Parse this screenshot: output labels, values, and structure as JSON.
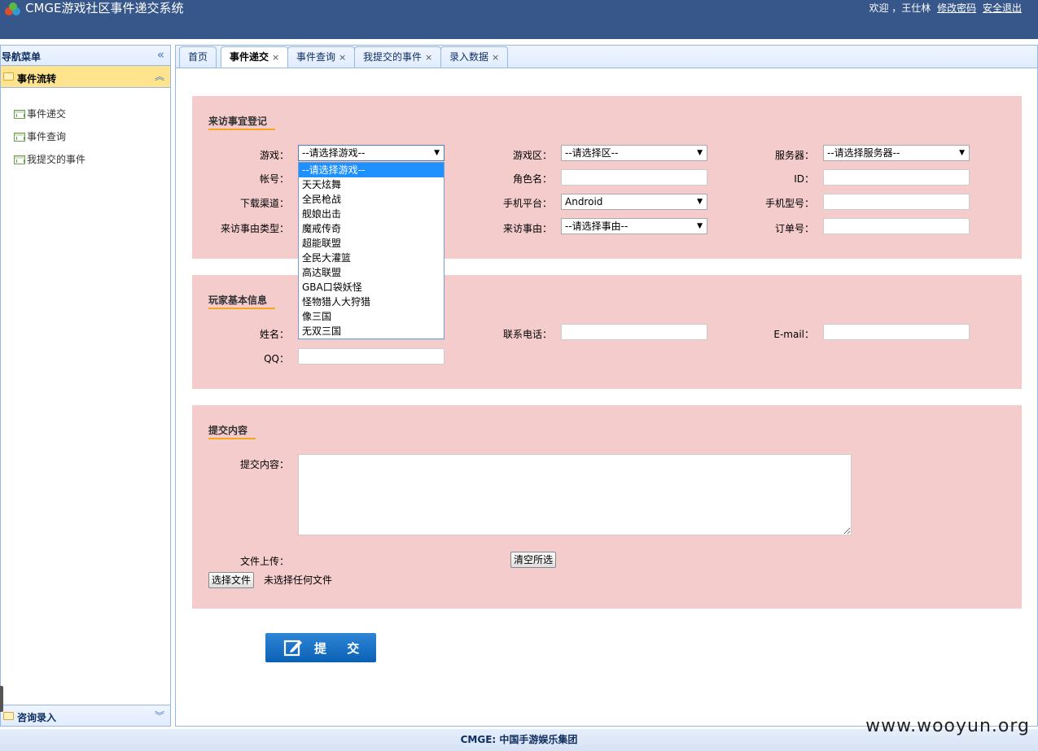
{
  "header": {
    "app_title": "CMGE游戏社区事件递交系统",
    "welcome": "欢迎 ，王仕林",
    "change_password": "修改密码",
    "logout": "安全退出"
  },
  "sidebar": {
    "title": "导航菜单",
    "section": "事件流转",
    "items": [
      {
        "label": "事件递交"
      },
      {
        "label": "事件查询"
      },
      {
        "label": "我提交的事件"
      }
    ],
    "bottom_section": "咨询录入"
  },
  "tabs": [
    {
      "label": "首页",
      "closable": false
    },
    {
      "label": "事件递交",
      "closable": true,
      "active": true
    },
    {
      "label": "事件查询",
      "closable": true
    },
    {
      "label": "我提交的事件",
      "closable": true
    },
    {
      "label": "录入数据",
      "closable": true
    }
  ],
  "tab_close_glyph": "×",
  "visit_panel": {
    "title": "来访事宜登记",
    "game_label": "游戏：",
    "game_value": "--请选择游戏--",
    "zone_label": "游戏区：",
    "zone_value": "--请选择区--",
    "server_label": "服务器：",
    "server_value": "--请选择服务器--",
    "account_label": "帐号：",
    "role_label": "角色名：",
    "id_label": "ID：",
    "channel_label": "下载渠道：",
    "platform_label": "手机平台：",
    "platform_value": "Android",
    "model_label": "手机型号：",
    "reason_type_label": "来访事由类型：",
    "reason_label": "来访事由：",
    "reason_value": "--请选择事由--",
    "order_label": "订单号："
  },
  "game_dropdown_options": [
    "--请选择游戏--",
    "天天炫舞",
    "全民枪战",
    "舰娘出击",
    "魔戒传奇",
    "超能联盟",
    "全民大灌篮",
    "高达联盟",
    "GBA口袋妖怪",
    "怪物猎人大狩猎",
    "像三国",
    "无双三国"
  ],
  "player_panel": {
    "title": "玩家基本信息",
    "name_label": "姓名：",
    "phone_label": "联系电话：",
    "email_label": "E-mail：",
    "qq_label": "QQ："
  },
  "content_panel": {
    "title": "提交内容",
    "content_label": "提交内容：",
    "upload_label": "文件上传：",
    "clear_button": "清空所选",
    "choose_file_button": "选择文件",
    "no_file_text": "未选择任何文件"
  },
  "submit_button": "提 交",
  "footer": "CMGE: 中国手游娱乐集团",
  "watermark": "www.wooyun.org",
  "icons": {
    "logo": "cmge-logo-icon",
    "collapse": "double-chevron-left-icon",
    "folder": "folder-icon",
    "document": "document-icon",
    "expand_up": "double-chevron-up-icon",
    "expand_down": "double-chevron-down-icon",
    "edit": "edit-icon"
  },
  "colors": {
    "header_bg": "#37578a",
    "panel_bg": "#f4cccc",
    "section_active_bg": "#ffe48d",
    "accent_underline": "#f5a623",
    "submit_bg": "#0a62b5",
    "dropdown_selected": "#1e90ff"
  }
}
